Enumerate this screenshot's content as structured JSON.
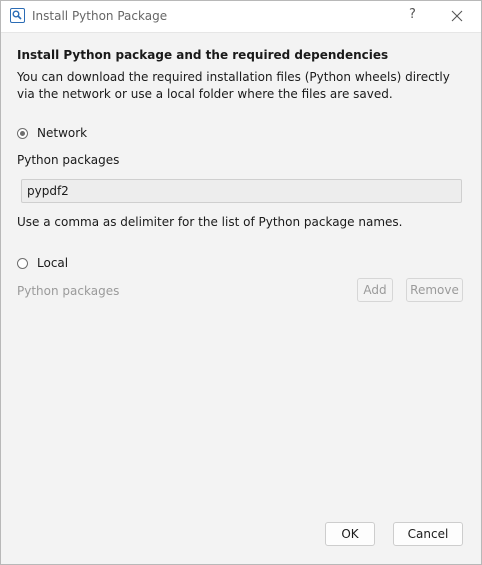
{
  "window": {
    "title": "Install Python Package",
    "help_glyph": "?",
    "icon": "search-icon",
    "close_icon": "close-icon"
  },
  "content": {
    "heading": "Install Python package and the required dependencies",
    "description": "You can download the required installation files (Python wheels) directly via the network or use a local folder where the files are saved."
  },
  "network": {
    "label": "Network",
    "selected": true,
    "packages_label": "Python packages",
    "packages_value": "pypdf2",
    "hint": "Use a comma as delimiter for the list of Python package names."
  },
  "local": {
    "label": "Local",
    "selected": false,
    "packages_label": "Python packages",
    "add_label": "Add",
    "remove_label": "Remove"
  },
  "footer": {
    "ok_label": "OK",
    "cancel_label": "Cancel"
  },
  "colors": {
    "accent": "#2b6cb5",
    "disabled_text": "#9a9a9a"
  }
}
